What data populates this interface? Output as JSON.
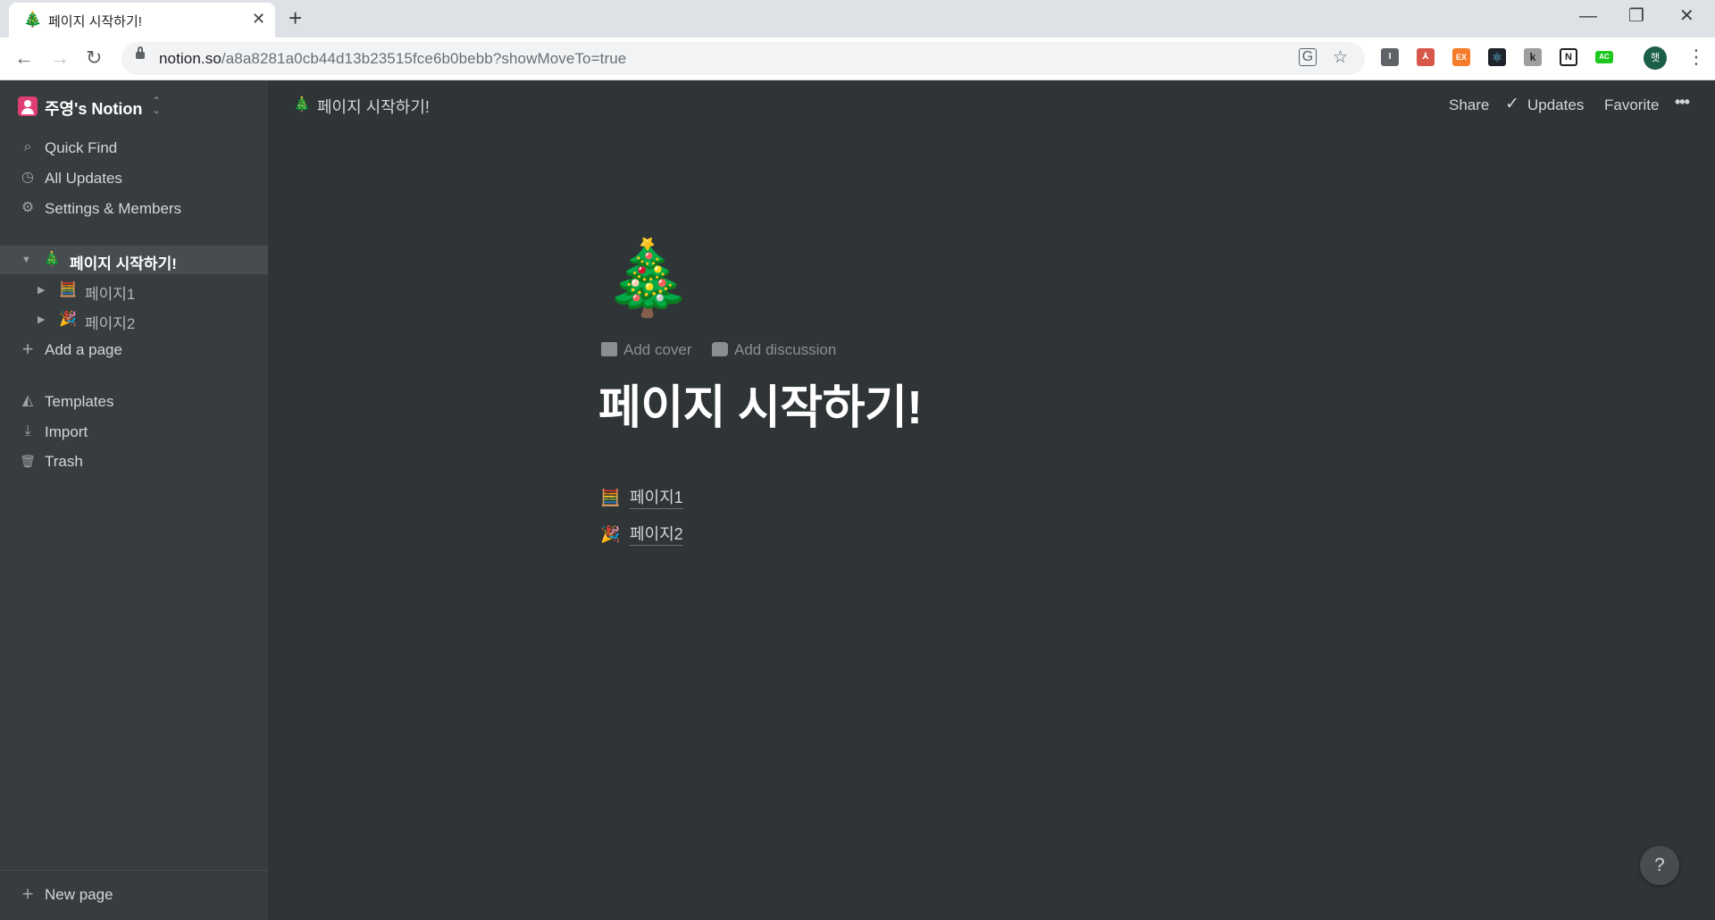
{
  "browser": {
    "tab": {
      "favicon": "🎄",
      "title": "페이지 시작하기!",
      "close": "✕"
    },
    "new_tab": "+",
    "window_controls": {
      "minimize": "—",
      "restore": "❐",
      "close": "✕"
    },
    "nav": {
      "back": "←",
      "forward": "→",
      "reload": "↻"
    },
    "url_host": "notion.so",
    "url_path": "/a8a8281a0cb44d13b23515fce6b0bebb?showMoveTo=true",
    "translate_icon": "translate-icon",
    "bookmark_icon": "star-icon",
    "extensions": [
      {
        "name": "extension-i",
        "label": "I",
        "color": "#5f6368"
      },
      {
        "name": "extension-pdf",
        "label": "⅄",
        "color": "#d7584a"
      },
      {
        "name": "extension-ex",
        "label": "EX",
        "color": "#f57c2b"
      },
      {
        "name": "extension-react",
        "label": "⚛",
        "color": "#20232a"
      },
      {
        "name": "extension-k",
        "label": "k",
        "color": "#9e9e9e"
      },
      {
        "name": "extension-notion",
        "label": "N",
        "color": "#202124"
      },
      {
        "name": "extension-ac",
        "label": "AC",
        "color": "#1ec71e"
      }
    ],
    "profile_initial": "햇",
    "menu": "⋮"
  },
  "sidebar": {
    "workspace_name": "주영's Notion",
    "workspace_caret": "⌃⌄",
    "nav_items": [
      {
        "icon": "search-icon",
        "glyph": "⌕",
        "label": "Quick Find"
      },
      {
        "icon": "clock-icon",
        "glyph": "◷",
        "label": "All Updates"
      },
      {
        "icon": "gear-icon",
        "glyph": "⚙",
        "label": "Settings & Members"
      }
    ],
    "pages": [
      {
        "emoji": "🎄",
        "label": "페이지 시작하기!",
        "toggle": "▼",
        "selected": true
      },
      {
        "emoji": "🧮",
        "label": "페이지1",
        "toggle": "▶",
        "selected": false
      },
      {
        "emoji": "🎉",
        "label": "페이지2",
        "toggle": "▶",
        "selected": false
      }
    ],
    "add_page": {
      "glyph": "+",
      "label": "Add a page"
    },
    "bottom_items": [
      {
        "icon": "templates-icon",
        "glyph": "◭",
        "label": "Templates"
      },
      {
        "icon": "import-icon",
        "glyph": "⤓",
        "label": "Import"
      },
      {
        "icon": "trash-icon",
        "glyph": "🗑",
        "label": "Trash"
      }
    ],
    "new_page": {
      "glyph": "+",
      "label": "New page"
    }
  },
  "topbar": {
    "emoji": "🎄",
    "breadcrumb": "페이지 시작하기!",
    "share": "Share",
    "updates_check": "✓",
    "updates": "Updates",
    "favorite": "Favorite",
    "more": "•••"
  },
  "page": {
    "icon": "🎄",
    "add_cover": "Add cover",
    "add_discussion": "Add discussion",
    "title": "페이지 시작하기!",
    "subpages": [
      {
        "emoji": "🧮",
        "label": "페이지1"
      },
      {
        "emoji": "🎉",
        "label": "페이지2"
      }
    ]
  },
  "help": "?"
}
